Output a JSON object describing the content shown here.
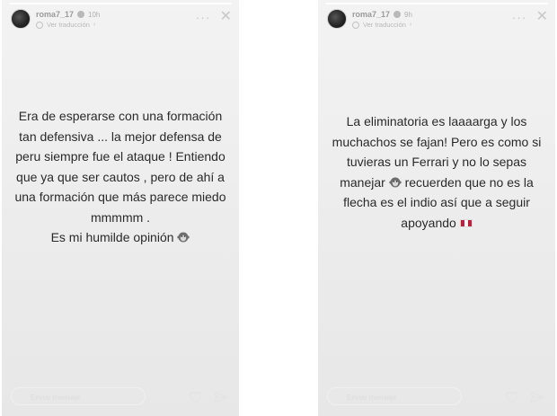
{
  "stories": [
    {
      "username": "roma7_17",
      "time": "10h",
      "translate_label": "Ver traducción",
      "lines": [
        "Era de esperarse con una formación",
        "tan defensiva ... la mejor defensa de",
        "peru siempre fue el ataque ! Entiendo",
        "que ya que ser cautos , pero de ahí a",
        "una formación que más parece miedo",
        "mmmmm ."
      ],
      "last_line": "Es mi humilde opinión",
      "reply_placeholder": "Enviar mensaje"
    },
    {
      "username": "roma7_17",
      "time": "9h",
      "translate_label": "Ver traducción",
      "lines": [
        "La eliminatoria es laaaarga y los",
        "muchachos se fajan! Pero es como si",
        "tuvieras un Ferrari y no lo sepas"
      ],
      "line4_a": "manejar",
      "line4_b": " recuerden que no es la",
      "line5": "flecha es el indio así que a seguir",
      "line6": "apoyando",
      "reply_placeholder": "Enviar mensaje"
    }
  ],
  "icons": {
    "emoji": "monkey-emoji",
    "flag": "peru-flag",
    "flag_colors": [
      "#c41e3a",
      "#ffffff",
      "#c41e3a"
    ]
  }
}
